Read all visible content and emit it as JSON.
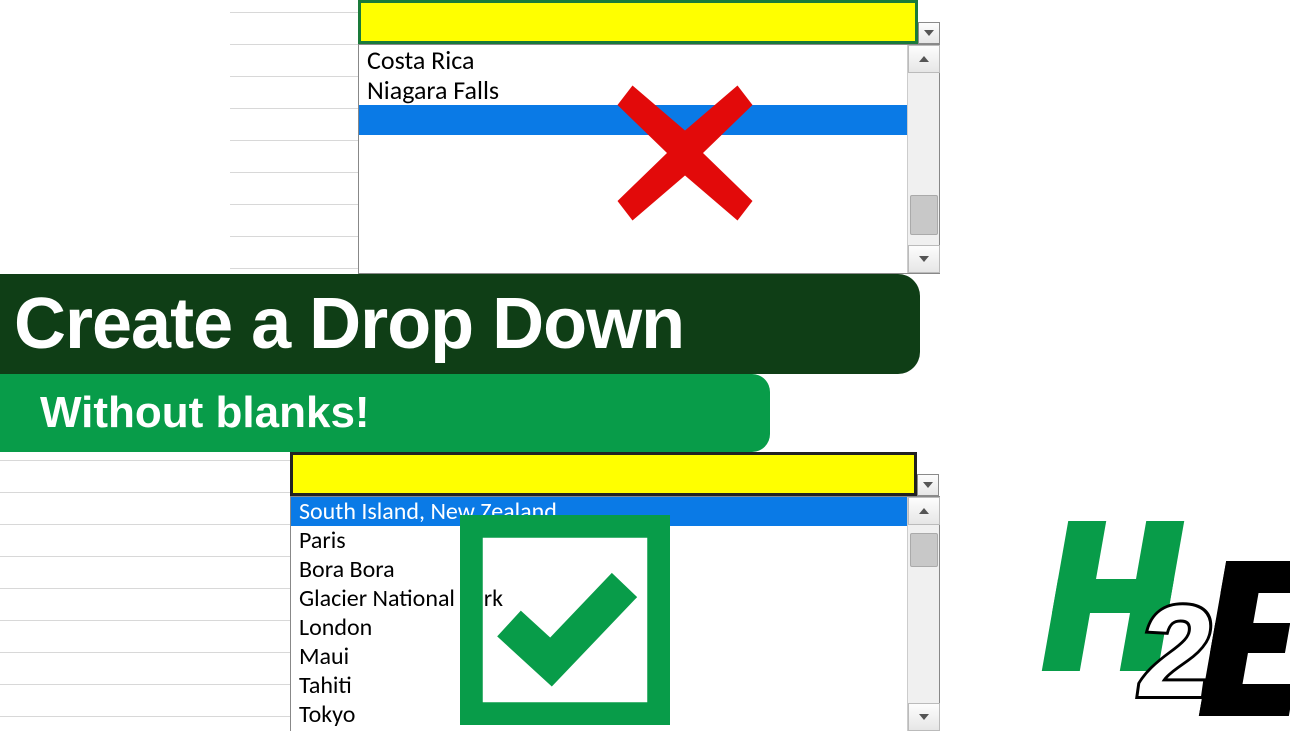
{
  "title_main": "Create a Drop Down",
  "title_sub": "Without blanks!",
  "dropdown_bad": {
    "items": [
      "Costa Rica",
      "Niagara Falls"
    ],
    "selected_index": 2
  },
  "dropdown_good": {
    "items": [
      "South Island, New Zealand",
      "Paris",
      "Bora Bora",
      "Glacier National Park",
      "London",
      "Maui",
      "Tahiti",
      "Tokyo"
    ],
    "selected_index": 0
  },
  "logo_text": {
    "h": "H",
    "two": "2",
    "e": "E"
  }
}
